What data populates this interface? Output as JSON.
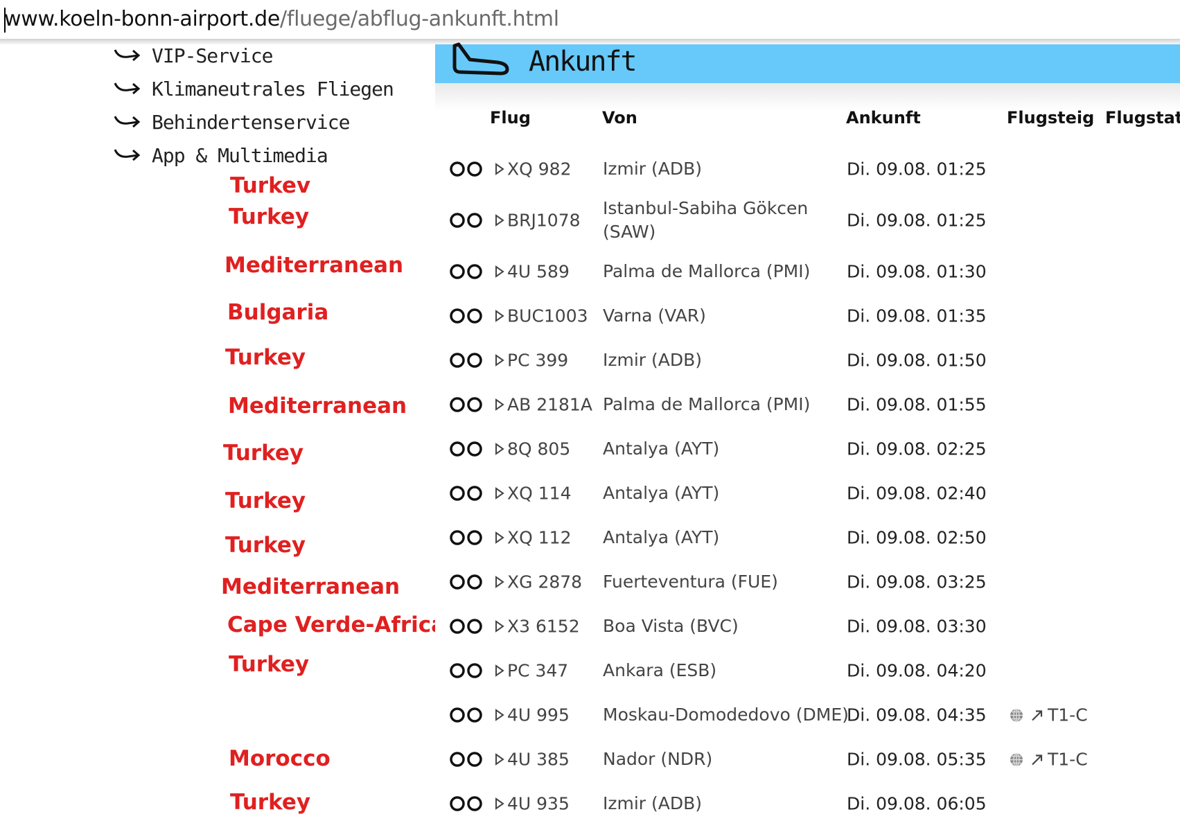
{
  "browser": {
    "url_host": "www.koeln-bonn-airport.de",
    "url_path": "/fluege/abflug-ankunft.html"
  },
  "nav": {
    "items": [
      {
        "label": "VIP-Service"
      },
      {
        "label": "Klimaneutrales Fliegen"
      },
      {
        "label": "Behindertenservice"
      },
      {
        "label": "App & Multimedia"
      }
    ]
  },
  "section": {
    "title": "Ankunft",
    "icon": "plane-landing-icon"
  },
  "table": {
    "headers": {
      "flight": "Flug",
      "from": "Von",
      "arrival": "Ankunft",
      "gate": "Flugsteig",
      "status": "Flugstat"
    },
    "rows": [
      {
        "flight": "XQ 982",
        "from": "Izmir (ADB)",
        "arrival": "Di. 09.08. 01:25",
        "gate": "",
        "annotation": "Turkev"
      },
      {
        "flight": "BRJ1078",
        "from": "Istanbul-Sabiha Gökcen (SAW)",
        "arrival": "Di. 09.08. 01:25",
        "gate": "",
        "annotation": "Turkey"
      },
      {
        "flight": "4U 589",
        "from": "Palma de Mallorca (PMI)",
        "arrival": "Di. 09.08. 01:30",
        "gate": "",
        "annotation": "Mediterranean"
      },
      {
        "flight": "BUC1003",
        "from": "Varna (VAR)",
        "arrival": "Di. 09.08. 01:35",
        "gate": "",
        "annotation": "Bulgaria"
      },
      {
        "flight": "PC 399",
        "from": "Izmir (ADB)",
        "arrival": "Di. 09.08. 01:50",
        "gate": "",
        "annotation": "Turkey"
      },
      {
        "flight": "AB 2181A",
        "from": "Palma de Mallorca (PMI)",
        "arrival": "Di. 09.08. 01:55",
        "gate": "",
        "annotation": "Mediterranean"
      },
      {
        "flight": "8Q 805",
        "from": "Antalya (AYT)",
        "arrival": "Di. 09.08. 02:25",
        "gate": "",
        "annotation": "Turkey"
      },
      {
        "flight": "XQ 114",
        "from": "Antalya (AYT)",
        "arrival": "Di. 09.08. 02:40",
        "gate": "",
        "annotation": "Turkey"
      },
      {
        "flight": "XQ 112",
        "from": "Antalya (AYT)",
        "arrival": "Di. 09.08. 02:50",
        "gate": "",
        "annotation": "Turkey"
      },
      {
        "flight": "XG 2878",
        "from": "Fuerteventura (FUE)",
        "arrival": "Di. 09.08. 03:25",
        "gate": "",
        "annotation": "Mediterranean"
      },
      {
        "flight": "X3 6152",
        "from": "Boa Vista (BVC)",
        "arrival": "Di. 09.08. 03:30",
        "gate": "",
        "annotation": "Cape Verde-Africa"
      },
      {
        "flight": "PC 347",
        "from": "Ankara (ESB)",
        "arrival": "Di. 09.08. 04:20",
        "gate": "",
        "annotation": "Turkey"
      },
      {
        "flight": "4U 995",
        "from": "Moskau-Domodedovo (DME)",
        "arrival": "Di. 09.08. 04:35",
        "gate": "T1-C",
        "annotation": ""
      },
      {
        "flight": "4U 385",
        "from": "Nador (NDR)",
        "arrival": "Di. 09.08. 05:35",
        "gate": "T1-C",
        "annotation": "Morocco"
      },
      {
        "flight": "4U 935",
        "from": "Izmir (ADB)",
        "arrival": "Di. 09.08. 06:05",
        "gate": "",
        "annotation": "Turkey"
      }
    ]
  },
  "colors": {
    "header_bar": "#66c9f9",
    "annotation": "#e02020"
  }
}
